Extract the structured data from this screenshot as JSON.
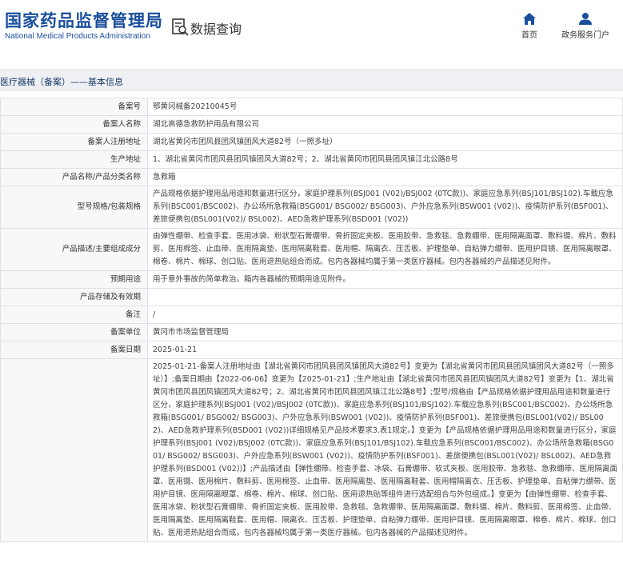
{
  "header": {
    "logo_cn": "国家药品监督管理局",
    "logo_en": "National Medical Products Administration",
    "query_title": "数据查询",
    "nav": [
      {
        "label": "首页",
        "icon": "home-icon"
      },
      {
        "label": "政务服务门户",
        "icon": "user-icon"
      }
    ]
  },
  "section_title": "医疗器械（备案）——基本信息",
  "rows": [
    {
      "label": "备案号",
      "value": "鄂黄冈械备20210045号"
    },
    {
      "label": "备案人名称",
      "value": "湖北高德急救防护用品有限公司"
    },
    {
      "label": "备案人注册地址",
      "value": "湖北省黄冈市团风县团风镇团风大道82号（一照多址）"
    },
    {
      "label": "生产地址",
      "value": "1、湖北省黄冈市团风县团风镇团风大道82号；2、湖北省黄冈市团风县团风镇江北公路8号"
    },
    {
      "label": "产品名称/产品分类名称",
      "value": "急救箱"
    },
    {
      "label": "型号规格/包装规格",
      "value": "产品规格依据护理用品用途和数量进行区分，家庭护理系列(BSJ001 (V02)/BSJ002 (0TC款))、家庭应急系列(BSJ101/BSJ102).车载应急系列(BSC001/BSC002)、办公场所急救箱(BSG001/ BSG002/ BSG003)、户外应急系列(BSW001 (V02))、疫情防护系列(BSF001)、差旅便携包(BSL001(V02)/ BSL002)、AED急救护理系列(BSD001 (V02))"
    },
    {
      "label": "产品描述/主要组成成分",
      "value": "由弹性绷带、检查手套、医用冰袋、粉状型石膏绷带、骨折固定夹板、医用胶带、急救毯、急救绷带、医用隔离面罩、敷料镊、棉片、敷料剪、医用棉签、止血带、医用隔离垫、医用隔离鞋套、医用帽、隔离衣、压舌板、护理垫单、自粘弹力绷带、医用护目镜、医用隔离眼罩、棉卷、棉片、棉球、创口贴、医用退热贴组合而成。包内各器械均属于第一类医疗器械。包内各器械的产品描述见附件。"
    },
    {
      "label": "预期用途",
      "value": "用于意外事故的简单救治。箱内各器械的预期用途见附件。"
    },
    {
      "label": "产品存储及有效期",
      "value": ""
    },
    {
      "label": "备注",
      "value": "/"
    },
    {
      "label": "备案单位",
      "value": "黄冈市市场监督管理局"
    },
    {
      "label": "备案日期",
      "value": "2025-01-21"
    }
  ],
  "change_row": {
    "label": "",
    "value": "2025-01-21-备案人注册地址由【湖北省黄冈市团风县团风镇团风大道82号】变更为【湖北省黄冈市团风县团风镇团风大道82号（一照多址）】;备案日期由【2022-06-06】变更为【2025-01-21】;生产地址由【湖北省黄冈市团风县团风镇团风大道82号】变更为【1、湖北省黄冈市团风县团风镇团风大道82号；2、湖北省黄冈市团风县团风镇江北公路8号】;型号/规格由【产品规格依据护理用品用途和数量进行区分，家庭护理系列(BSJ001 (V02)/BSJ002 (0TC款))、家庭应急系列(BSJ101/BSJ102).车载应急系列(BSC001/BSC002)、办公场所急救箱(BSG001/ BSG002/ BSG003)、户外应急系列(BSW001 (V02))、疫情防护系列(BSF001)、差旅便携包(BSL001(V02)/ BSL002)、AED急救护理系列(BSD001 (V02))详细规格见产品技术要求3.表1规定。】变更为【产品规格依据护理用品用途和数量进行区分，家庭护理系列(BSJ001 (V02)/BSJ002 (0TC款))、家庭应急系列(BSJ101/BSJ102).车载应急系列(BSC001/BSC002)、办公场所急救箱(BSG001/ BSG002/ BSG003)、户外应急系列(BSW001 (V02))、疫情防护系列(BSF001)、差旅便携包(BSL001(V02)/ BSL002)、AED急救护理系列(BSD001 (V02))】;产品描述由【弹性绷带、检查手套、冰袋、石膏绷带、软式夹板、医用胶带、急救毯、急救绷带、医用隔离面罩、医用镊、医用棉片、敷料剪、医用棉签、止血带、医用隔离垫、医用隔离鞋套、医用帽隔离衣、压舌板、护理垫单、自粘弹力绷带、医用护目镜、医用隔离眼罩、棉卷、棉片、棉球、创口贴、医用退热贴等组件进行选配组合与外包组成。】变更为【由弹性绷带、检查手套、医用冰袋、粉状型石膏绷带、骨折固定夹板、医用胶带、急救毯、急救绷带、医用隔离面罩、敷料镊、棉片、敷料剪、医用棉签、止血带、医用隔离垫、医用隔离鞋套、医用帽、隔离衣、压舌板、护理垫单、自粘弹力绷带、医用护目镜、医用隔离眼罩、棉卷、棉片、棉球、创口贴、医用退热贴组合而成。包内各器械均属于第一类医疗器械。包内各器械的产品描述见附件。"
  }
}
